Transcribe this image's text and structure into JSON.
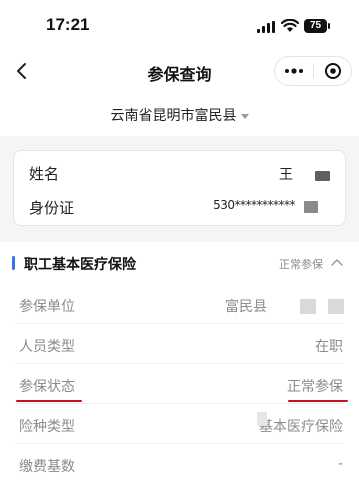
{
  "status_bar": {
    "time": "17:21",
    "battery": "75",
    "icons": [
      "signal-icon",
      "wifi-icon",
      "battery-icon"
    ]
  },
  "nav": {
    "title": "参保查询",
    "back_icon": "chevron-left-icon",
    "more_icon": "more-dots-icon",
    "close_icon": "target-close-icon"
  },
  "region": {
    "label": "云南省昆明市富民县",
    "icon": "caret-down-icon"
  },
  "person": {
    "name_label": "姓名",
    "name_value": "王",
    "id_label": "身份证",
    "id_value": "530***********"
  },
  "section": {
    "title": "职工基本医疗保险",
    "status": "正常参保",
    "accent_color": "#3a73e8",
    "toggle_icon": "chevron-up-icon"
  },
  "details": [
    {
      "label": "参保单位",
      "value": "富民县"
    },
    {
      "label": "人员类型",
      "value": "在职"
    },
    {
      "label": "参保状态",
      "value": "正常参保"
    },
    {
      "label": "险种类型",
      "value": "基本医疗保险"
    },
    {
      "label": "缴费基数",
      "value": "-"
    }
  ],
  "annotation_color": "#c1121f"
}
